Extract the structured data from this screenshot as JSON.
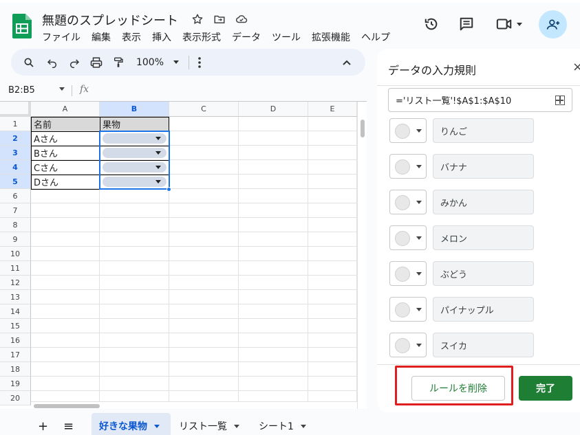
{
  "app": {
    "doc_title": "無題のスプレッドシート",
    "menu": [
      "ファイル",
      "編集",
      "表示",
      "挿入",
      "表示形式",
      "データ",
      "ツール",
      "拡張機能",
      "ヘルプ"
    ],
    "icons": [
      "star-icon",
      "move-folder-icon",
      "cloud-icon",
      "history-icon",
      "comment-icon",
      "video-icon",
      "share-person-icon"
    ]
  },
  "toolbar": {
    "zoom": "100%"
  },
  "formula_bar": {
    "name_box": "B2:B5",
    "fx": "fx"
  },
  "grid": {
    "columns": [
      "A",
      "B",
      "C",
      "D",
      "E"
    ],
    "rows": [
      "1",
      "2",
      "3",
      "4",
      "5",
      "6",
      "7",
      "8",
      "9",
      "10",
      "11",
      "12",
      "13",
      "14",
      "15",
      "16",
      "17",
      "18",
      "19",
      "20"
    ],
    "cells": {
      "A1": "名前",
      "B1": "果物",
      "A2": "Aさん",
      "A3": "Bさん",
      "A4": "Cさん",
      "A5": "Dさん"
    }
  },
  "tabs": {
    "add": "+",
    "list": "≡",
    "sheets": [
      "好きな果物",
      "リスト一覧",
      "シート1"
    ]
  },
  "panel": {
    "title": "データの入力規則",
    "close": "×",
    "range": "='リスト一覧'!$A$1:$A$10",
    "items": [
      "りんご",
      "バナナ",
      "みかん",
      "メロン",
      "ぶどう",
      "パイナップル",
      "スイカ"
    ],
    "remove_label": "ルールを削除",
    "done_label": "完了"
  },
  "colors": {
    "accent": "#1a73e8",
    "done_green": "#1e7e34",
    "highlight_red": "#e01e1e",
    "selection_fill": "#d3e3fd"
  }
}
